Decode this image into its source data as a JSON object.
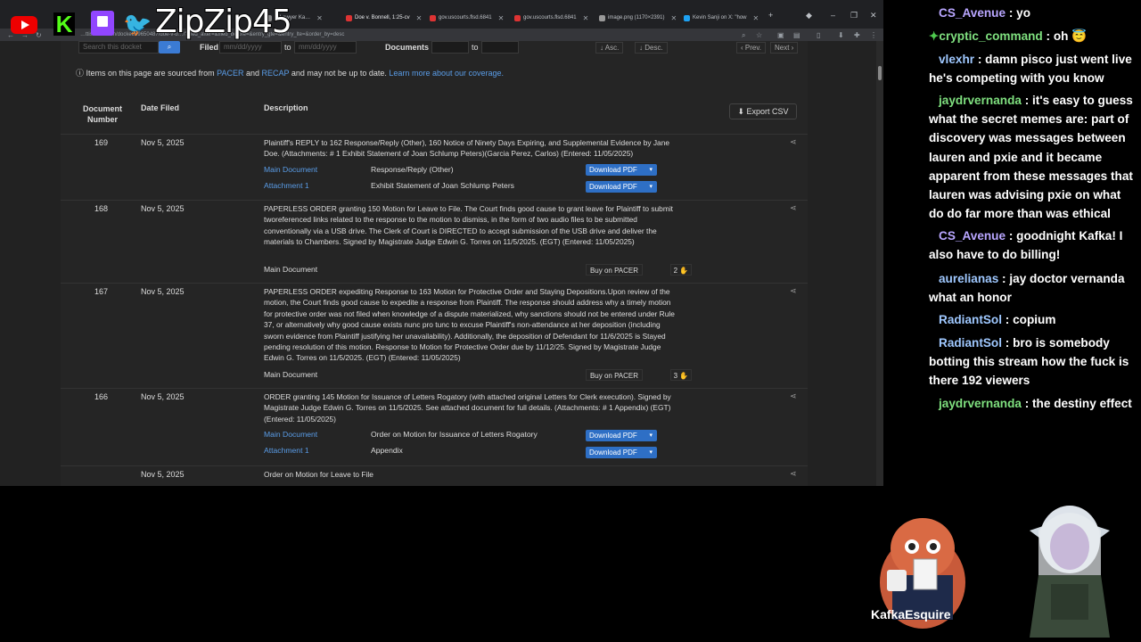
{
  "overlay": {
    "channel_name": "ZipZip45",
    "logos": [
      "youtube-icon",
      "kick-icon",
      "twitch-icon",
      "twitter-icon"
    ],
    "avatar_label": "KafkaEsquire"
  },
  "browser": {
    "tabs": [
      {
        "label": "'s Lawyer Ka…",
        "active": false
      },
      {
        "label": "Doe v. Bonnell, 1:25-cv",
        "active": true
      },
      {
        "label": "gov.uscourts.flsd.6841",
        "active": false
      },
      {
        "label": "gov.uscourts.flsd.6841",
        "active": false
      },
      {
        "label": "image.png (1170×2391)",
        "active": false
      },
      {
        "label": "Kevin Sanji on X: \"how",
        "active": false
      }
    ],
    "url": "…ttistener.com/docket/69650487/doe-v-b…/?filed_after=&filed_before=&entry_gte=&entry_lte=&order_by=desc"
  },
  "filters": {
    "search_placeholder": "Search this docket",
    "filed_label": "Filed",
    "date_placeholder": "mm/dd/yyyy",
    "to_label": "to",
    "documents_label": "Documents",
    "asc_label": "↓ Asc.",
    "desc_label": "↓ Desc.",
    "prev_label": "‹ Prev.",
    "next_label": "Next ›"
  },
  "notice": {
    "prefix": "Items on this page are sourced from ",
    "pacer": "PACER",
    "and": " and ",
    "recap": "RECAP",
    "suffix": " and may not be up to date. ",
    "learn_more": "Learn more about our coverage."
  },
  "table": {
    "headers": {
      "doc_number": "Document Number",
      "date_filed": "Date Filed",
      "description": "Description"
    },
    "export_label": "Export CSV",
    "rows": [
      {
        "number": "169",
        "date": "Nov 5, 2025",
        "description": "Plaintiff's REPLY to 162 Response/Reply (Other), 160 Notice of Ninety Days Expiring, and Supplemental Evidence by Jane Doe. (Attachments: # 1 Exhibit Statement of Joan Schlump Peters)(Garcia Perez, Carlos) (Entered: 11/05/2025)",
        "docs": [
          {
            "name": "Main Document",
            "desc": "Response/Reply (Other)",
            "action": "Download PDF"
          },
          {
            "name": "Attachment 1",
            "desc": "Exhibit Statement of Joan Schlump Peters",
            "action": "Download PDF"
          }
        ]
      },
      {
        "number": "168",
        "date": "Nov 5, 2025",
        "description": "PAPERLESS ORDER granting 150 Motion for Leave to File. The Court finds good cause to grant leave for Plaintiff to submit tworeferenced links related to the response to the motion to dismiss, in the form of two audio files to be submitted conventionally via a USB drive. The Clerk of Court is DIRECTED to accept submission of the USB drive and deliver the materials to Chambers. Signed by Magistrate Judge Edwin G. Torres on 11/5/2025. (EGT) (Entered: 11/05/2025)",
        "docs": [
          {
            "name": "Main Document",
            "desc": "",
            "action": "Buy on PACER",
            "count": "2"
          }
        ]
      },
      {
        "number": "167",
        "date": "Nov 5, 2025",
        "description": "PAPERLESS ORDER expediting Response to 163 Motion for Protective Order and Staying Depositions.Upon review of the motion, the Court finds good cause to expedite a response from Plaintiff. The response should address why a timely motion for protective order was not filed when knowledge of a dispute materialized, why sanctions should not be entered under Rule 37, or alternatively why good cause exists nunc pro tunc to excuse Plaintiff's non-attendance at her deposition (including sworn evidence from Plaintiff justifying her unavailability). Additionally, the deposition of Defendant for 11/6/2025 is Stayed pending resolution of this motion. Response to Motion for Protective Order due by 11/12/25. Signed by Magistrate Judge Edwin G. Torres on 11/5/2025. (EGT) (Entered: 11/05/2025)",
        "docs": [
          {
            "name": "Main Document",
            "desc": "",
            "action": "Buy on PACER",
            "count": "3"
          }
        ]
      },
      {
        "number": "166",
        "date": "Nov 5, 2025",
        "description": "ORDER granting 145 Motion for Issuance of Letters Rogatory (with attached original Letters for Clerk execution). Signed by Magistrate Judge Edwin G. Torres on 11/5/2025. See attached document for full details. (Attachments: # 1 Appendix) (EGT) (Entered: 11/05/2025)",
        "docs": [
          {
            "name": "Main Document",
            "desc": "Order on Motion for Issuance of Letters Rogatory",
            "action": "Download PDF"
          },
          {
            "name": "Attachment 1",
            "desc": "Appendix",
            "action": "Download PDF"
          }
        ]
      },
      {
        "number": "",
        "date": "Nov 5, 2025",
        "description": "Order on Motion for Leave to File",
        "docs": []
      }
    ]
  },
  "chat": [
    {
      "user": "CS_Avenue",
      "color": "#b9a6ff",
      "text": "yo"
    },
    {
      "user": "cryptic_command",
      "color": "#7fe07f",
      "text": "oh 😇",
      "icon": "✦"
    },
    {
      "user": "vlexhr",
      "color": "#9fc8ff",
      "text": "damn pisco just went live he's competing with you know"
    },
    {
      "user": "jaydrvernanda",
      "color": "#7fe07f",
      "text": "it's easy to guess what the secret memes are: part of discovery was messages between lauren and pxie and it became apparent from these messages that lauren was advising pxie on what do do far more than was ethical"
    },
    {
      "user": "CS_Avenue",
      "color": "#b9a6ff",
      "text": "goodnight Kafka! I also have to do billing!"
    },
    {
      "user": "aurelianas",
      "color": "#9fc8ff",
      "text": "jay doctor vernanda what an honor"
    },
    {
      "user": "RadiantSol",
      "color": "#9fc8ff",
      "text": "copium"
    },
    {
      "user": "RadiantSol",
      "color": "#9fc8ff",
      "text": "bro is somebody botting this stream how the fuck is there 192 viewers"
    },
    {
      "user": "jaydrvernanda",
      "color": "#7fe07f",
      "text": "the destiny effect"
    }
  ]
}
